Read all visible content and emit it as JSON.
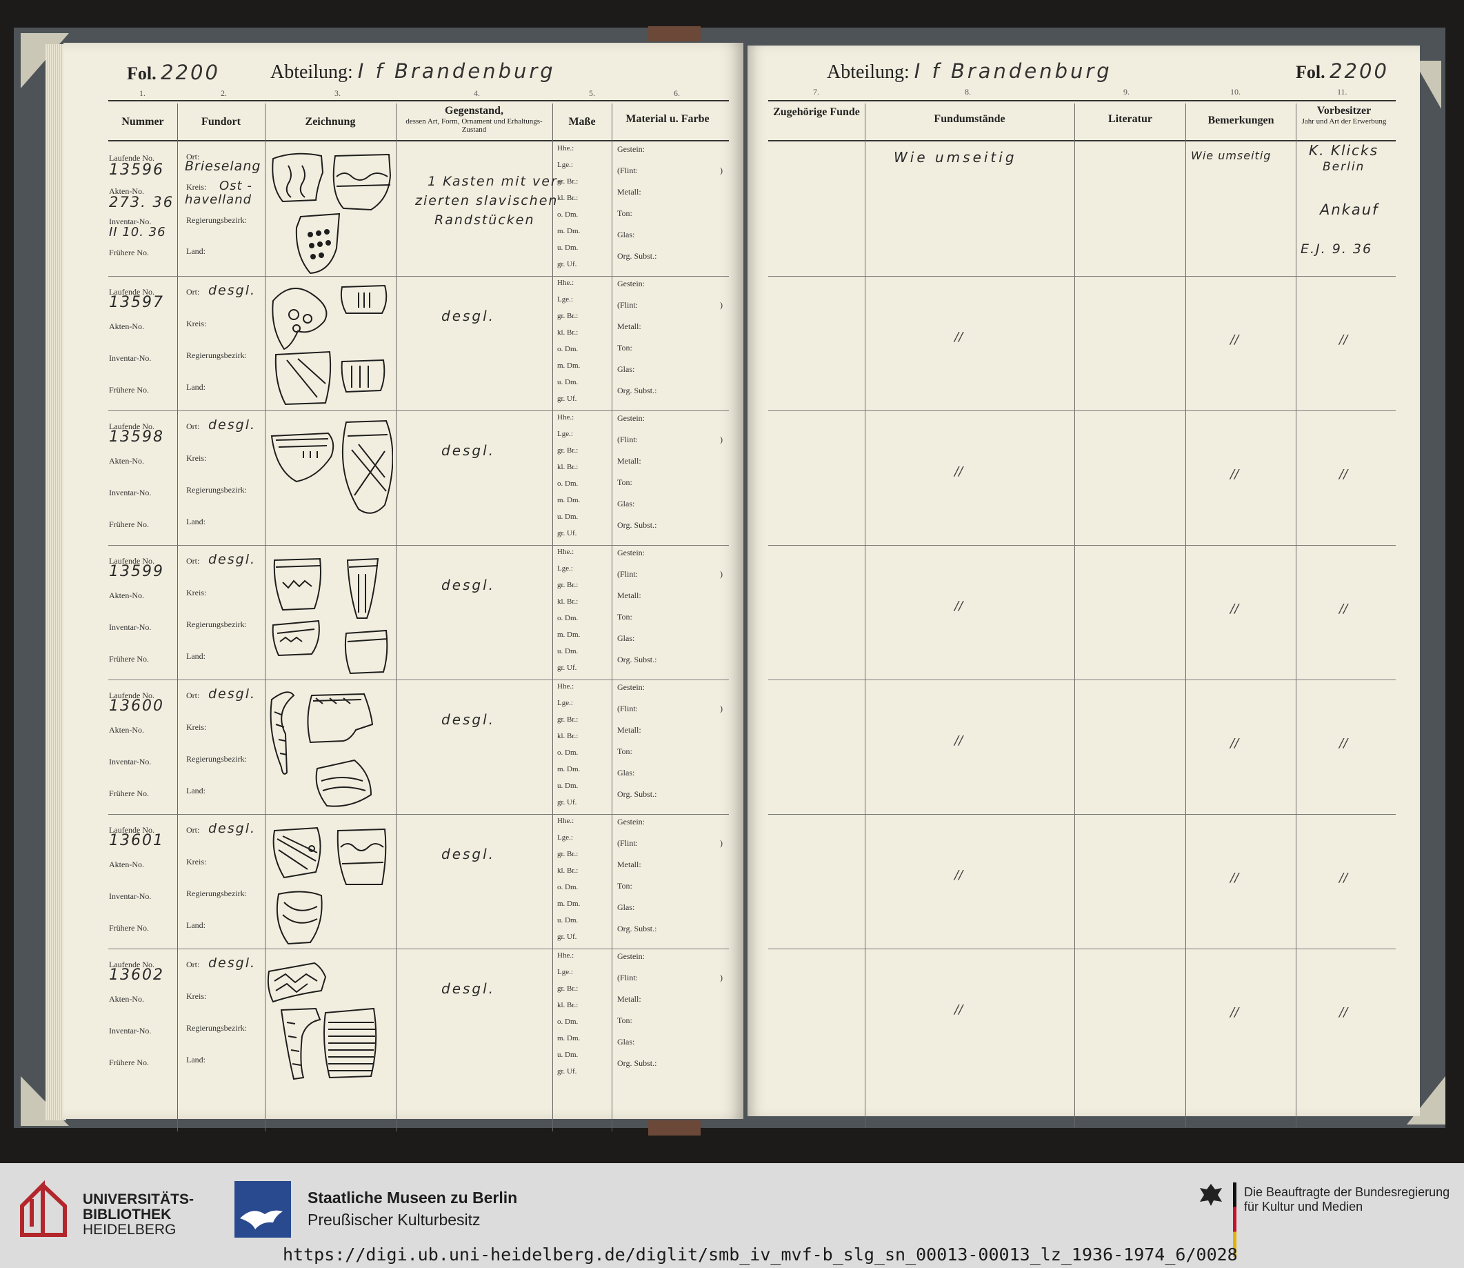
{
  "folio": {
    "label": "Fol.",
    "number": "2200"
  },
  "abteilung": {
    "label": "Abteilung:",
    "value": "I f  Brandenburg"
  },
  "column_numbers": [
    "1.",
    "2.",
    "3.",
    "4.",
    "5.",
    "6.",
    "7.",
    "8.",
    "9.",
    "10.",
    "11."
  ],
  "left_headers": {
    "nummer": "Nummer",
    "fundort": "Fundort",
    "zeichnung": "Zeichnung",
    "gegenstand": "Gegenstand,",
    "gegenstand_sub": "dessen Art, Form, Ornament und Erhaltungs-Zustand",
    "masse": "Maße",
    "material": "Material u. Farbe"
  },
  "right_headers": {
    "zugehoerige": "Zugehörige Funde",
    "fundumstaende": "Fundumstände",
    "literatur": "Literatur",
    "bemerkungen": "Bemerkungen",
    "vorbesitzer": "Vorbesitzer",
    "vorbesitzer_sub": "Jahr und Art der Erwerbung"
  },
  "row_labels": {
    "laufende": "Laufende No.",
    "akten": "Akten-No.",
    "inventar": "Inventar-No.",
    "fruehere": "Frühere No.",
    "ort": "Ort:",
    "kreis": "Kreis:",
    "bezirk": "Regierungsbezirk:",
    "land": "Land:"
  },
  "masse_labels": [
    "Hhe.:",
    "Lge.:",
    "gr. Br.:",
    "kl. Br.:",
    "o. Dm.",
    "m. Dm.",
    "u. Dm.",
    "gr. Uf."
  ],
  "material_labels": {
    "gestein": "Gestein:",
    "flint": "(Flint:",
    "flint_close": ")",
    "metall": "Metall:",
    "ton": "Ton:",
    "glas": "Glas:",
    "org": "Org. Subst.:"
  },
  "ditto": "//",
  "entries": [
    {
      "lfd": "13596",
      "akten": "273. 36",
      "inventar": "II  10. 36",
      "ort": "Brieselang",
      "kreis": "Ost -",
      "kreis2": "havelland",
      "gegenstand": [
        "1 Kasten mit ver-",
        "zierten slavischen",
        "Randstücken"
      ],
      "fundumstaende": "Wie   umseitig",
      "bemerkungen": "Wie umseitig",
      "vorbesitzer": [
        "K. Klicks",
        "Berlin"
      ],
      "erwerb": "Ankauf",
      "ej": "E.J.  9. 36"
    },
    {
      "lfd": "13597",
      "ort": "desgl.",
      "gegenstand": [
        "desgl."
      ]
    },
    {
      "lfd": "13598",
      "ort": "desgl.",
      "gegenstand": [
        "desgl."
      ]
    },
    {
      "lfd": "13599",
      "ort": "desgl.",
      "gegenstand": [
        "desgl."
      ]
    },
    {
      "lfd": "13600",
      "ort": "desgl.",
      "gegenstand": [
        "desgl."
      ]
    },
    {
      "lfd": "13601",
      "ort": "desgl.",
      "gegenstand": [
        "desgl."
      ]
    },
    {
      "lfd": "13602",
      "ort": "desgl.",
      "gegenstand": [
        "desgl."
      ]
    }
  ],
  "footer": {
    "ub": [
      "UNIVERSITÄTS-",
      "BIBLIOTHEK",
      "HEIDELBERG"
    ],
    "smb": [
      "Staatliche Museen zu Berlin",
      "Preußischer Kulturbesitz"
    ],
    "bkm": [
      "Die Beauftragte der Bundesregierung",
      "für Kultur und Medien"
    ],
    "url": "https://digi.ub.uni-heidelberg.de/diglit/smb_iv_mvf-b_slg_sn_00013-00013_lz_1936-1974_6/0028"
  },
  "colors": {
    "paper": "#f2eedf",
    "cover": "#4d5357",
    "footer": "#dcdcdc",
    "smb_blue": "#2a4a8f",
    "ub_red": "#b2262c"
  }
}
